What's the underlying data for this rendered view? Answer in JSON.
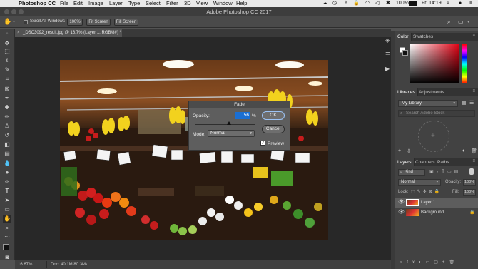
{
  "menubar": {
    "app": "Photoshop CC",
    "items": [
      "File",
      "Edit",
      "Image",
      "Layer",
      "Type",
      "Select",
      "Filter",
      "3D",
      "View",
      "Window",
      "Help"
    ],
    "clock": "Fri 14:19",
    "battery": "100%"
  },
  "window": {
    "title": "Adobe Photoshop CC 2017"
  },
  "options": {
    "scroll_all": "Scroll All Windows",
    "zoom100": "100%",
    "fit_screen": "Fit Screen",
    "fill_screen": "Fill Screen"
  },
  "document": {
    "tab": "_DSC3092_result.jpg @ 16.7% (Layer 1, RGB/8#) *"
  },
  "status": {
    "zoom": "16.67%",
    "doc": "Doc: 40.1M/80.3M"
  },
  "fade": {
    "title": "Fade",
    "opacity_label": "Opacity:",
    "opacity_value": "56",
    "opacity_unit": "%",
    "opacity_fraction": 0.56,
    "mode_label": "Mode:",
    "mode_value": "Normal",
    "ok": "OK",
    "cancel": "Cancel",
    "preview": "Preview"
  },
  "panels": {
    "color_tabs": [
      "Color",
      "Swatches"
    ],
    "lib_tabs": [
      "Libraries",
      "Adjustments"
    ],
    "library": "My Library",
    "lib_search": "Search Adobe Stock",
    "layer_tabs": [
      "Layers",
      "Channels",
      "Paths"
    ],
    "kind": "Kind",
    "blend": "Normal",
    "opacity_label": "Opacity:",
    "opacity": "100%",
    "lock_label": "Lock:",
    "fill_label": "Fill:",
    "fill": "100%",
    "layers": [
      "Layer 1",
      "Background"
    ]
  },
  "colors": {
    "accent": "#1473e6",
    "panel": "#424242",
    "canvas_bg": "#282828"
  }
}
